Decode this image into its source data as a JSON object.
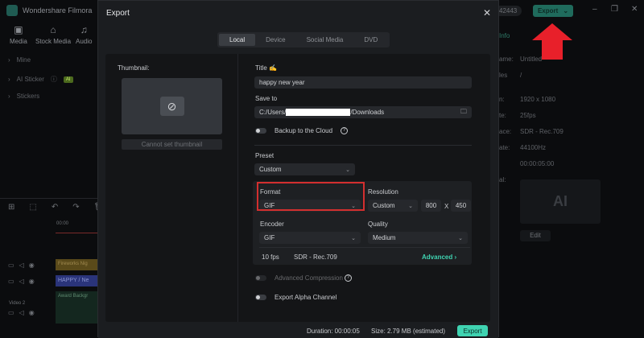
{
  "app": {
    "title": "Wondershare Filmora",
    "credits": "42443",
    "export_label": "Export",
    "toolbar": [
      {
        "icon": "media-icon",
        "label": "Media"
      },
      {
        "icon": "stock-media-icon",
        "label": "Stock Media"
      },
      {
        "icon": "audio-icon",
        "label": "Audio"
      }
    ],
    "sidebar": [
      {
        "label": "Mine"
      },
      {
        "label": "AI Sticker",
        "badge": "AI"
      },
      {
        "label": "Stickers"
      }
    ],
    "info_tab": "Info",
    "info": [
      {
        "label": "ame:",
        "value": "Untitled"
      },
      {
        "label": "les",
        "value": "/"
      },
      {
        "label": "n:",
        "value": "1920 x 1080"
      },
      {
        "label": "te:",
        "value": "25fps"
      },
      {
        "label": "ace:",
        "value": "SDR - Rec.709"
      },
      {
        "label": "ate:",
        "value": "44100Hz"
      },
      {
        "label": "",
        "value": "00:00:05:00"
      },
      {
        "label": "al:",
        "value": ""
      }
    ],
    "edit_label": "Edit",
    "timeline": {
      "time": "00:00",
      "clips": [
        "Fireworks Nig",
        "HAPPY / Ne",
        "Award Backgr"
      ],
      "track_label": "Video 2"
    }
  },
  "dialog": {
    "title": "Export",
    "tabs": [
      "Local",
      "Device",
      "Social Media",
      "DVD"
    ],
    "thumbnail_label": "Thumbnail:",
    "thumbnail_button": "Cannot set thumbnail",
    "title_label": "Title",
    "title_value": "happy new year",
    "save_to_label": "Save to",
    "save_to_prefix": "C:/Users/",
    "save_to_suffix": "/Downloads",
    "backup_label": "Backup to the Cloud",
    "preset_label": "Preset",
    "preset_value": "Custom",
    "format_label": "Format",
    "format_value": "GIF",
    "resolution_label": "Resolution",
    "resolution_value": "Custom",
    "width": "800",
    "x": "X",
    "height": "450",
    "encoder_label": "Encoder",
    "encoder_value": "GIF",
    "quality_label": "Quality",
    "quality_value": "Medium",
    "fps": "10 fps",
    "color_space": "SDR - Rec.709",
    "advanced_label": "Advanced",
    "advanced_compression_label": "Advanced Compression",
    "alpha_label": "Export Alpha Channel",
    "duration": "Duration: 00:00:05",
    "size": "Size:  2.79 MB (estimated)",
    "export_button": "Export"
  },
  "colors": {
    "accent": "#3fd3b1",
    "highlight": "#d32f2f",
    "arrow": "#e8202a"
  }
}
